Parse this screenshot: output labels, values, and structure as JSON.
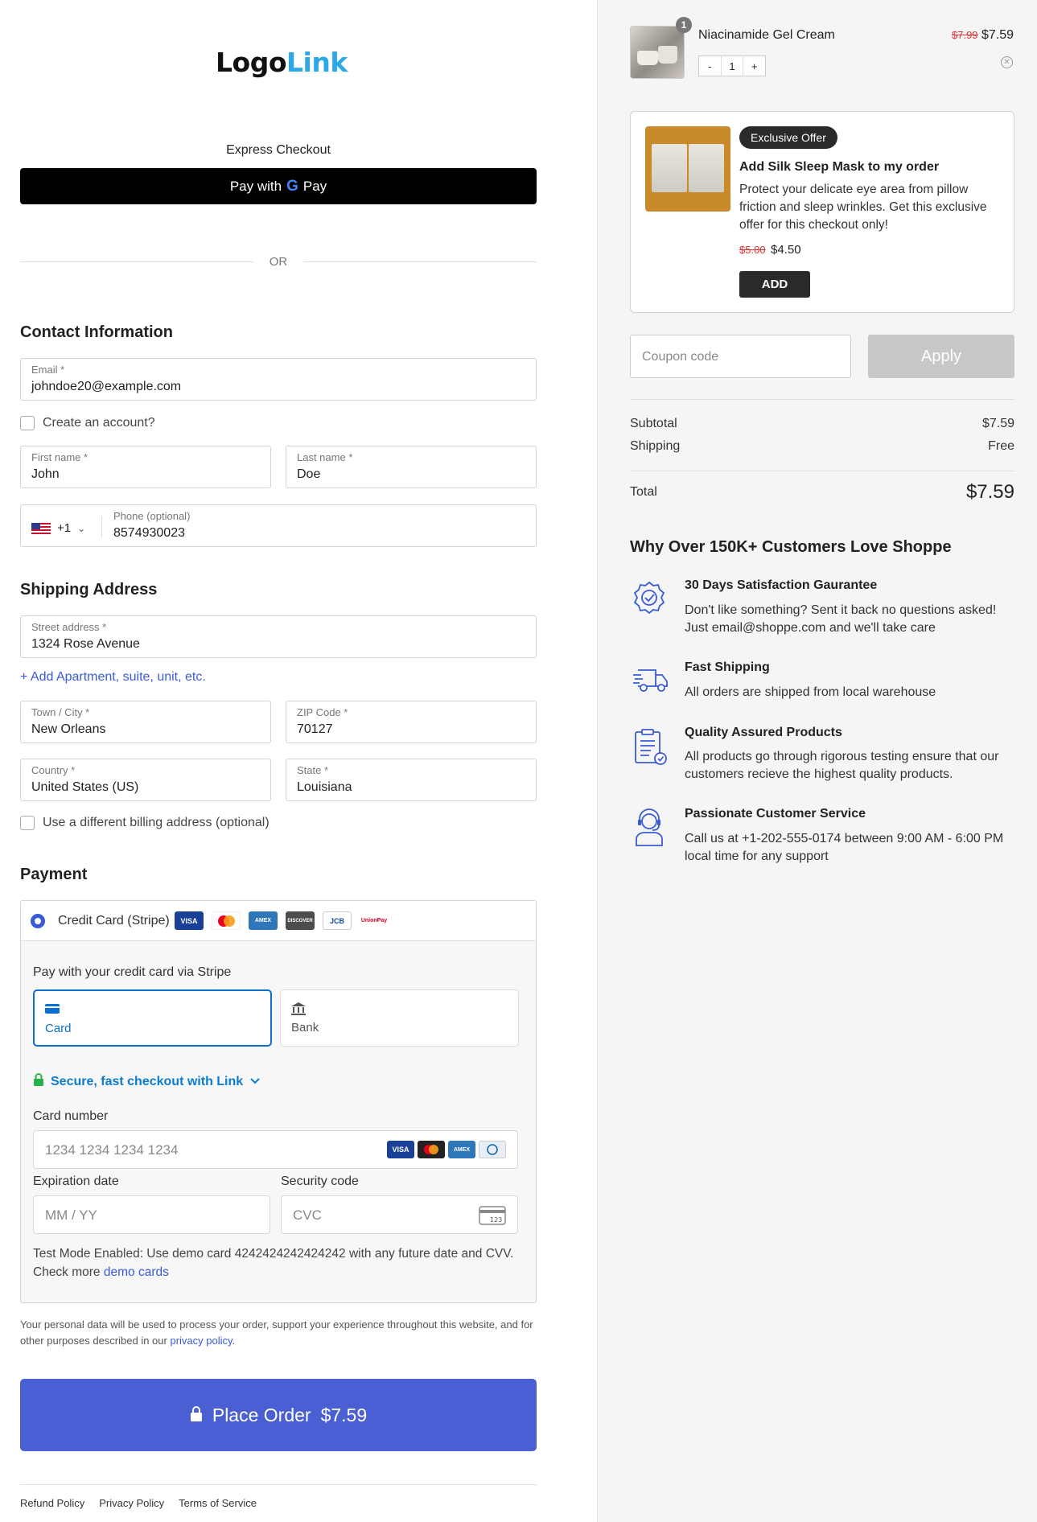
{
  "logo": {
    "part1": "Logo",
    "part2": "Link"
  },
  "express": {
    "label": "Express Checkout",
    "button": "Pay with",
    "gpay_text": "Pay"
  },
  "or_text": "OR",
  "contact": {
    "title": "Contact Information",
    "email": {
      "label": "Email *",
      "value": "johndoe20@example.com"
    },
    "create_account": "Create an account?",
    "first_name": {
      "label": "First name *",
      "value": "John"
    },
    "last_name": {
      "label": "Last name *",
      "value": "Doe"
    },
    "phone": {
      "code": "+1",
      "label": "Phone (optional)",
      "value": "8574930023"
    }
  },
  "shipping": {
    "title": "Shipping Address",
    "street": {
      "label": "Street address *",
      "value": "1324 Rose Avenue"
    },
    "add_apartment": "Add Apartment, suite, unit, etc.",
    "town": {
      "label": "Town / City *",
      "value": "New Orleans"
    },
    "zip": {
      "label": "ZIP Code *",
      "value": "70127"
    },
    "country": {
      "label": "Country *",
      "value": "United States (US)"
    },
    "state": {
      "label": "State *",
      "value": "Louisiana"
    },
    "billing_checkbox": "Use a different billing address (optional)"
  },
  "payment": {
    "title": "Payment",
    "method": "Credit Card (Stripe)",
    "card_brands": [
      "VISA",
      "MC",
      "AMEX",
      "DISCOVER",
      "JCB",
      "UnionPay"
    ],
    "sub": "Pay with your credit card via Stripe",
    "tab_card": "Card",
    "tab_bank": "Bank",
    "link_text": "Secure, fast checkout with Link",
    "card_number_label": "Card number",
    "card_number_placeholder": "1234 1234 1234 1234",
    "expiry_label": "Expiration date",
    "expiry_placeholder": "MM / YY",
    "cvc_label": "Security code",
    "cvc_placeholder": "CVC",
    "test_note": "Test Mode Enabled: Use demo card 4242424242424242 with any future date and CVV. Check more",
    "demo_link": "demo cards"
  },
  "privacy": {
    "text": "Your personal data will be used to process your order, support your experience throughout this website, and for other purposes described in our",
    "link": "privacy policy",
    "end": "."
  },
  "place_order": {
    "label": "Place Order",
    "amount": "$7.59"
  },
  "footer": [
    "Refund Policy",
    "Privacy Policy",
    "Terms of Service"
  ],
  "cart": {
    "count": "1",
    "product_name": "Niacinamide Gel Cream",
    "old_price": "$7.99",
    "price": "$7.59",
    "qty_minus": "-",
    "qty_value": "1",
    "qty_plus": "+"
  },
  "offer": {
    "badge": "Exclusive Offer",
    "title": "Add Silk Sleep Mask to my order",
    "desc": "Protect your delicate eye area from pillow friction and sleep wrinkles. Get this exclusive offer for this checkout only!",
    "old_price": "$5.00",
    "price": "$4.50",
    "button": "ADD"
  },
  "coupon": {
    "placeholder": "Coupon code",
    "button": "Apply"
  },
  "totals": {
    "subtotal_label": "Subtotal",
    "subtotal": "$7.59",
    "shipping_label": "Shipping",
    "shipping": "Free",
    "total_label": "Total",
    "total": "$7.59"
  },
  "why": {
    "title": "Why Over 150K+ Customers Love Shoppe",
    "features": [
      {
        "title": "30 Days Satisfaction Gaurantee",
        "desc": "Don't like something? Sent it back no questions asked! Just email@shoppe.com and we'll take care",
        "icon": "badge-check-icon"
      },
      {
        "title": "Fast Shipping",
        "desc": "All orders are shipped from local warehouse",
        "icon": "truck-icon"
      },
      {
        "title": "Quality Assured Products",
        "desc": "All products go through rigorous testing ensure that our customers recieve the highest quality products.",
        "icon": "clipboard-check-icon"
      },
      {
        "title": "Passionate Customer Service",
        "desc": "Call us at +1-202-555-0174 between 9:00 AM - 6:00 PM local time for any support",
        "icon": "headset-agent-icon"
      }
    ]
  },
  "colors": {
    "accent": "#4a5fd4",
    "link": "#3b5bd6",
    "logo_blue": "#2aa8e8",
    "stripe_blue": "#0a7ccf"
  }
}
